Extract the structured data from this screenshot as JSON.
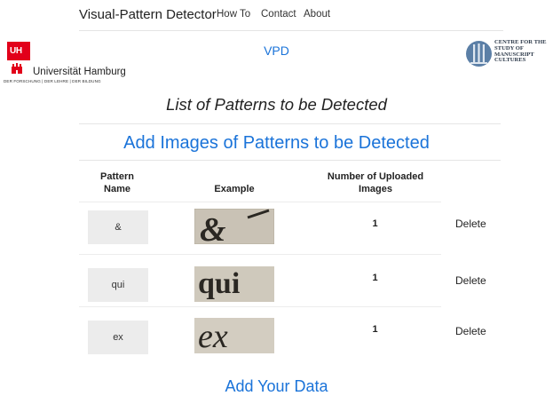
{
  "navbar": {
    "brand": "Visual-Pattern Detector",
    "links": [
      "How To",
      "Contact",
      "About"
    ]
  },
  "header": {
    "center_title": "VPD",
    "uhh_logo": {
      "box": "UH",
      "name": "Universität Hamburg",
      "motto": "DER FORSCHUNG | DER LEHRE | DER BILDUNG"
    },
    "cscs_logo": {
      "lines": [
        "CENTRE FOR THE",
        "STUDY OF",
        "MANUSCRIPT",
        "CULTURES"
      ]
    }
  },
  "main": {
    "list_title": "List of Patterns to be Detected",
    "add_title": "Add Images of Patterns to be Detected",
    "table": {
      "headers": {
        "pattern_name": [
          "Pattern",
          "Name"
        ],
        "example": "Example",
        "uploaded": [
          "Number of Uploaded",
          "Images"
        ]
      },
      "rows": [
        {
          "name": "&",
          "count": "1",
          "delete": "Delete"
        },
        {
          "name": "qui",
          "count": "1",
          "delete": "Delete"
        },
        {
          "name": "ex",
          "count": "1",
          "delete": "Delete"
        }
      ]
    },
    "data_title": "Add Your Data"
  },
  "colors": {
    "accent": "#1a73d9",
    "uhh_red": "#e2001a",
    "button_bg": "#ececec"
  }
}
